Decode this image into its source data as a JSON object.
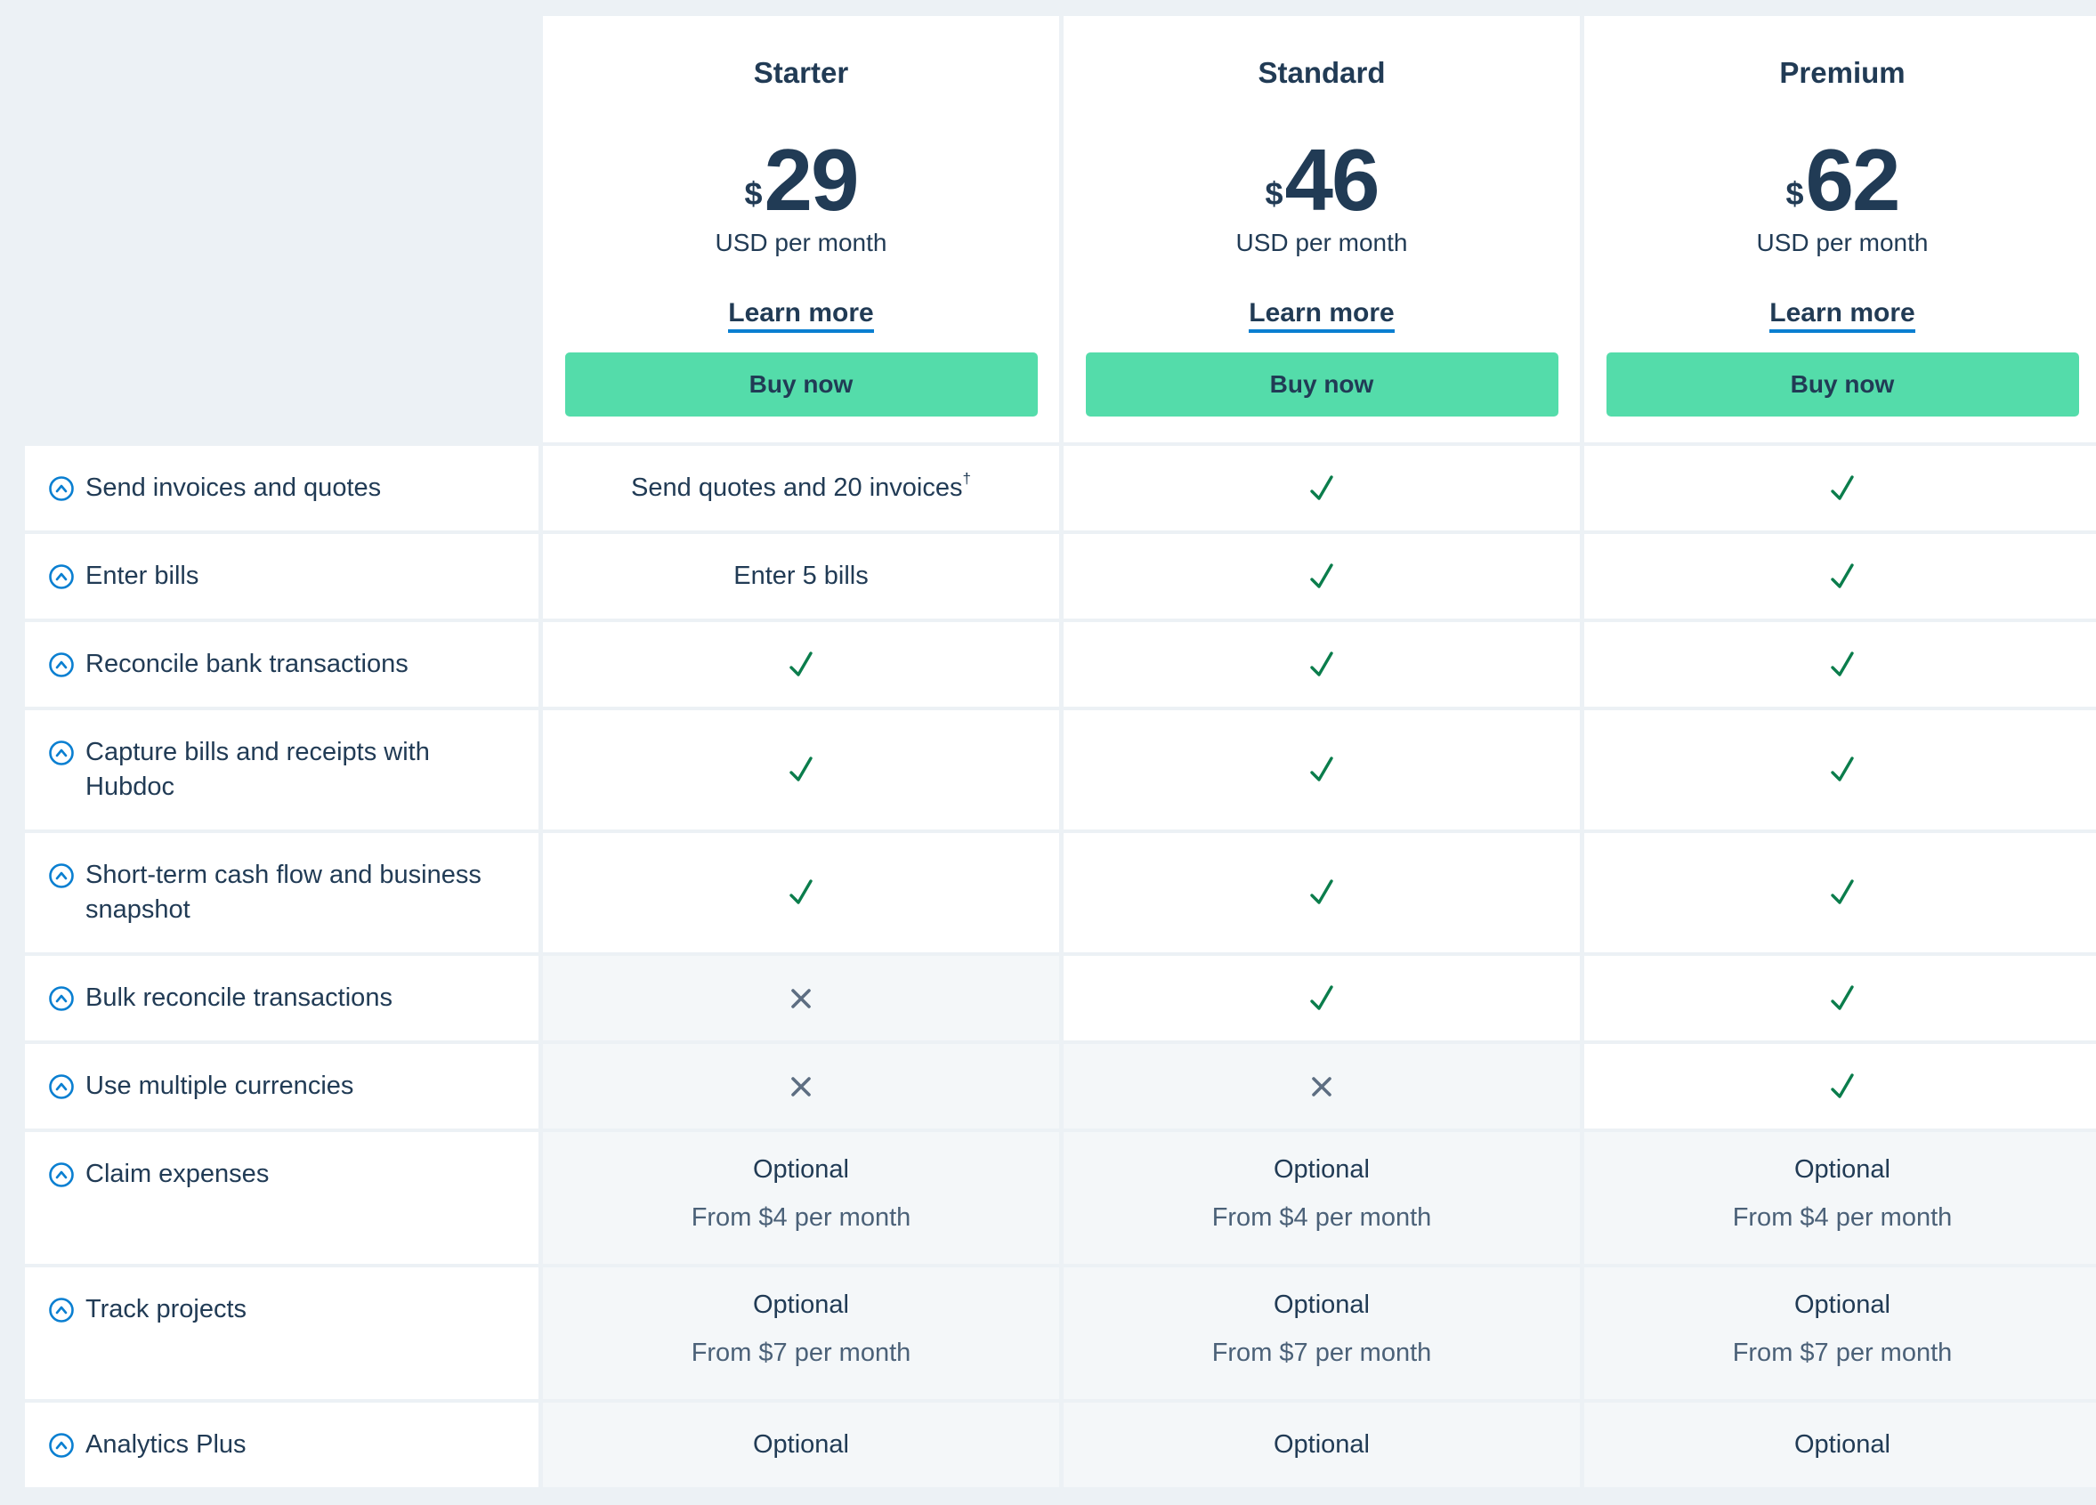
{
  "colors": {
    "brand_text": "#213b55",
    "buy_button": "#54dcaa",
    "link_underline": "#0a7fd1",
    "check": "#0b7d4c",
    "cross": "#5d6e82",
    "icon": "#0a7fd1"
  },
  "plans": [
    {
      "name": "Starter",
      "currency_symbol": "$",
      "price": "29",
      "period": "USD per month",
      "learn_more": "Learn more",
      "buy_label": "Buy now"
    },
    {
      "name": "Standard",
      "currency_symbol": "$",
      "price": "46",
      "period": "USD per month",
      "learn_more": "Learn more",
      "buy_label": "Buy now"
    },
    {
      "name": "Premium",
      "currency_symbol": "$",
      "price": "62",
      "period": "USD per month",
      "learn_more": "Learn more",
      "buy_label": "Buy now"
    }
  ],
  "features": [
    {
      "label": "Send invoices and quotes",
      "icon": "expand-chevron-circle-icon",
      "values": [
        {
          "type": "text",
          "text": "Send quotes and 20 invoices",
          "sup": "†"
        },
        {
          "type": "check"
        },
        {
          "type": "check"
        }
      ]
    },
    {
      "label": "Enter bills",
      "icon": "expand-chevron-circle-icon",
      "values": [
        {
          "type": "text",
          "text": "Enter 5 bills"
        },
        {
          "type": "check"
        },
        {
          "type": "check"
        }
      ]
    },
    {
      "label": "Reconcile bank transactions",
      "icon": "expand-chevron-circle-icon",
      "values": [
        {
          "type": "check"
        },
        {
          "type": "check"
        },
        {
          "type": "check"
        }
      ]
    },
    {
      "label": "Capture bills and receipts with Hubdoc",
      "icon": "expand-chevron-circle-icon",
      "values": [
        {
          "type": "check"
        },
        {
          "type": "check"
        },
        {
          "type": "check"
        }
      ]
    },
    {
      "label": "Short-term cash flow and business snapshot",
      "icon": "expand-chevron-circle-icon",
      "values": [
        {
          "type": "check"
        },
        {
          "type": "check"
        },
        {
          "type": "check"
        }
      ]
    },
    {
      "label": "Bulk reconcile transactions",
      "icon": "expand-chevron-circle-icon",
      "values": [
        {
          "type": "cross"
        },
        {
          "type": "check"
        },
        {
          "type": "check"
        }
      ]
    },
    {
      "label": "Use multiple currencies",
      "icon": "expand-chevron-circle-icon",
      "values": [
        {
          "type": "cross"
        },
        {
          "type": "cross"
        },
        {
          "type": "check"
        }
      ]
    },
    {
      "label": "Claim expenses",
      "icon": "expand-chevron-circle-icon",
      "values": [
        {
          "type": "optional",
          "text": "Optional",
          "sub": "From $4 per month"
        },
        {
          "type": "optional",
          "text": "Optional",
          "sub": "From $4 per month"
        },
        {
          "type": "optional",
          "text": "Optional",
          "sub": "From $4 per month"
        }
      ]
    },
    {
      "label": "Track projects",
      "icon": "expand-chevron-circle-icon",
      "values": [
        {
          "type": "optional",
          "text": "Optional",
          "sub": "From $7 per month"
        },
        {
          "type": "optional",
          "text": "Optional",
          "sub": "From $7 per month"
        },
        {
          "type": "optional",
          "text": "Optional",
          "sub": "From $7 per month"
        }
      ]
    },
    {
      "label": "Analytics Plus",
      "icon": "expand-chevron-circle-icon",
      "values": [
        {
          "type": "optional",
          "text": "Optional"
        },
        {
          "type": "optional",
          "text": "Optional"
        },
        {
          "type": "optional",
          "text": "Optional"
        }
      ]
    }
  ]
}
